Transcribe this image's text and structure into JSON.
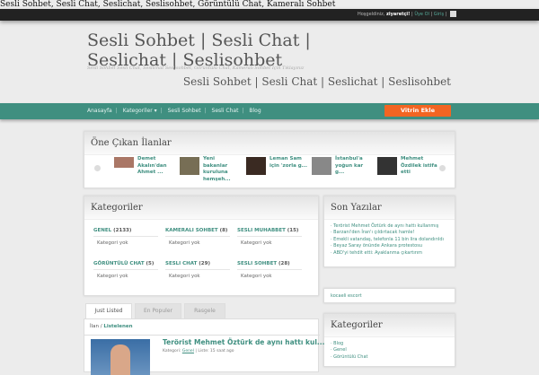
{
  "page_title": "Sesli Sohbet, Sesli Chat, Seslichat, Seslisohbet, Görüntülü Chat, Kameralı Sohbet",
  "topbar": {
    "welcome": "Hoşgeldiniz,",
    "user": "ziyaretçi!",
    "register": "Üye Ol",
    "login": "Giriş",
    "rss_icon": "rss-icon"
  },
  "header": {
    "title": "Sesli Sohbet | Sesli Chat | Seslichat | Seslisohbet",
    "tagline": "Sesli Sohbet Sesli Chat, Seslichat Seslisohbet, Görüntülü Chat, Kameralı Sohbet İçin Tıklayınız",
    "subtitle": "Sesli Sohbet | Sesli Chat | Seslichat | Seslisohbet"
  },
  "nav": {
    "items": [
      "Anasayfa",
      "Kategoriler ▾",
      "Sesli Sohbet",
      "Sesli Chat",
      "Blog"
    ],
    "cta": "Vitrin Ekle"
  },
  "featured": {
    "title": "Öne Çıkan İlanlar",
    "items": [
      "Demet Akalın'dan Ahmet ...",
      "Yeni bakanlar kuruluna hemşeh...",
      "Leman Sam için 'zorla g...",
      "İstanbul'a yoğun kar g...",
      "Mehmet Özdilek istifa etti"
    ]
  },
  "categories": {
    "title": "Kategoriler",
    "items": [
      {
        "name": "GENEL",
        "count": "(2133)",
        "sub": "Kategori yok"
      },
      {
        "name": "KAMERALI SOHBET",
        "count": "(8)",
        "sub": "Kategori yok"
      },
      {
        "name": "SESLI MUHABBET",
        "count": "(15)",
        "sub": "Kategori yok"
      },
      {
        "name": "GÖRÜNTÜLÜ CHAT",
        "count": "(5)",
        "sub": "Kategori yok"
      },
      {
        "name": "SESLI CHAT",
        "count": "(29)",
        "sub": "Kategori yok"
      },
      {
        "name": "SESLI SOHBET",
        "count": "(28)",
        "sub": "Kategori yok"
      }
    ]
  },
  "recent": {
    "title": "Son Yazılar",
    "items": [
      "· Terörist Mehmet Öztürk de aynı hattı kullanmış",
      "· Barzani'den İran'ı çıldırtacak hamle!",
      "· Emekli vatandaş, telefonla 11 bin lira dolandırıldı",
      "· Beyaz Saray önünde Ankara protestosu",
      "· ABD'yi tehdit etti: Ayaklanma çıkartırım"
    ]
  },
  "link_widget": "kocaeli escort",
  "sidebar_categories": {
    "title": "Kategoriler",
    "items": [
      "· Blog",
      "· Genel",
      "· Görüntülü Chat"
    ]
  },
  "tabs": [
    "Just Listed",
    "En Populer",
    "Rasgele"
  ],
  "breadcrumb": {
    "a": "İlan /",
    "b": "Listelenen"
  },
  "post": {
    "title": "Terörist Mehmet Öztürk de aynı hattı kul...",
    "meta_label": "Kategori:",
    "meta_cat": "Genel",
    "meta_rest": "| Liste: 15 saat ago"
  }
}
